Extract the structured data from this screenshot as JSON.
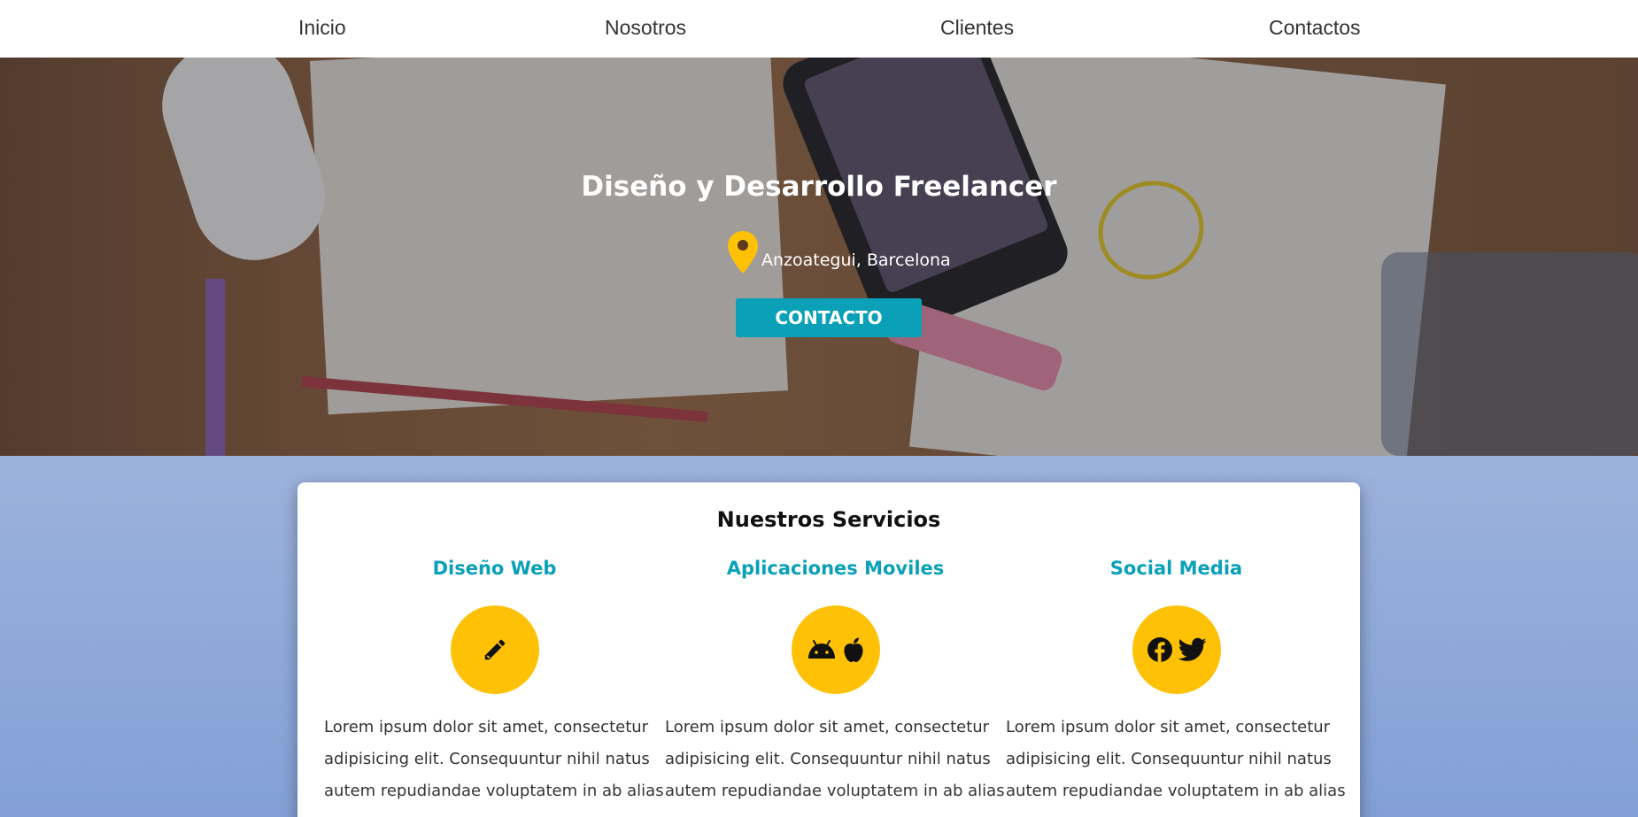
{
  "nav": {
    "items": [
      {
        "label": "Inicio"
      },
      {
        "label": "Nosotros"
      },
      {
        "label": "Clientes"
      },
      {
        "label": "Contactos"
      }
    ]
  },
  "hero": {
    "title": "Diseño y Desarrollo Freelancer",
    "location": "Anzoategui, Barcelona",
    "location_icon": "map-pin-icon",
    "cta_label": "CONTACTO",
    "colors": {
      "cta": "#0aa0b8",
      "pin": "#fec106"
    }
  },
  "services": {
    "title": "Nuestros Servicios",
    "items": [
      {
        "title": "Diseño Web",
        "icons": [
          "pencil-icon"
        ],
        "text": "Lorem ipsum dolor sit amet, consectetur adipisicing elit. Consequuntur nihil natus autem repudiandae voluptatem in ab alias"
      },
      {
        "title": "Aplicaciones Moviles",
        "icons": [
          "android-icon",
          "apple-icon"
        ],
        "text": "Lorem ipsum dolor sit amet, consectetur adipisicing elit. Consequuntur nihil natus autem repudiandae voluptatem in ab alias"
      },
      {
        "title": "Social Media",
        "icons": [
          "facebook-icon",
          "twitter-icon"
        ],
        "text": "Lorem ipsum dolor sit amet, consectetur adipisicing elit. Consequuntur nihil natus autem repudiandae voluptatem in ab alias"
      }
    ],
    "colors": {
      "accent": "#0aa0b8",
      "circle": "#fec106",
      "background": "#8fa9d9"
    }
  }
}
